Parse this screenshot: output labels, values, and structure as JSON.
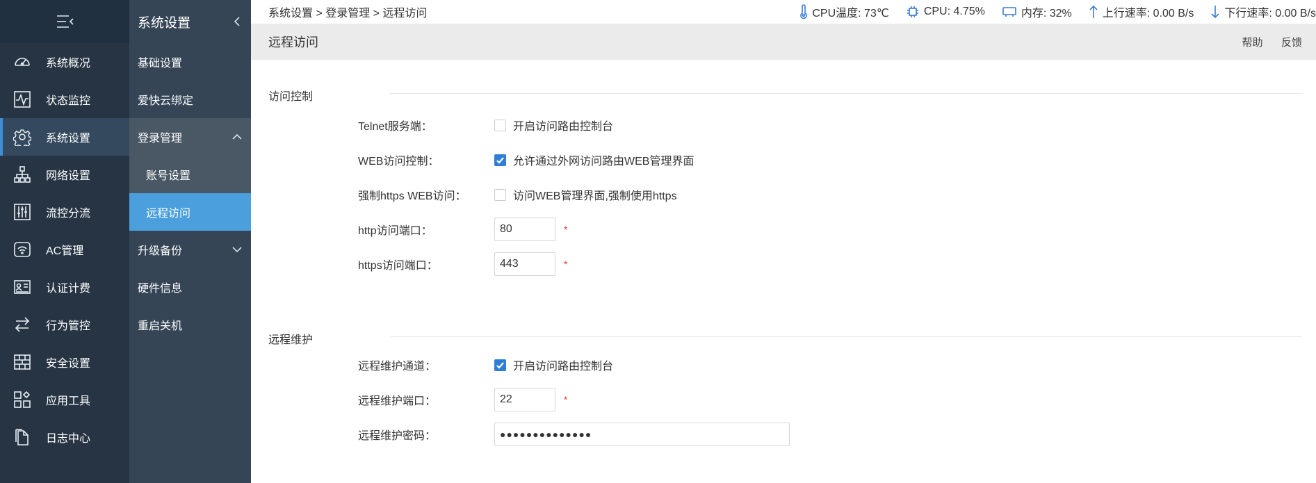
{
  "nav1": {
    "items": [
      {
        "label": "系统概况",
        "icon": "dashboard-icon"
      },
      {
        "label": "状态监控",
        "icon": "monitor-icon"
      },
      {
        "label": "系统设置",
        "icon": "gear-icon"
      },
      {
        "label": "网络设置",
        "icon": "network-icon"
      },
      {
        "label": "流控分流",
        "icon": "sliders-icon"
      },
      {
        "label": "AC管理",
        "icon": "wifi-icon"
      },
      {
        "label": "认证计费",
        "icon": "id-card-icon"
      },
      {
        "label": "行为管控",
        "icon": "arrows-icon"
      },
      {
        "label": "安全设置",
        "icon": "firewall-icon"
      },
      {
        "label": "应用工具",
        "icon": "apps-icon"
      },
      {
        "label": "日志中心",
        "icon": "document-icon"
      }
    ]
  },
  "nav2": {
    "title": "系统设置",
    "items": {
      "basic": "基础设置",
      "cloud": "爱快云绑定",
      "login": "登录管理",
      "account": "账号设置",
      "remote": "远程访问",
      "upgrade": "升级备份",
      "hardware": "硬件信息",
      "reboot": "重启关机"
    }
  },
  "topbar": {
    "breadcrumb": "系统设置 > 登录管理 > 远程访问",
    "cpu_temp": "CPU温度: 73℃",
    "cpu": "CPU: 4.75%",
    "memory": "内存: 32%",
    "upload": "上行速率: 0.00 B/s",
    "download": "下行速率: 0.00 B/s"
  },
  "titlebar": {
    "title": "远程访问",
    "help": "帮助",
    "feedback": "反馈"
  },
  "access": {
    "section": "访问控制",
    "telnet_label": "Telnet服务端：",
    "telnet_text": "开启访问路由控制台",
    "telnet_checked": false,
    "web_label": "WEB访问控制：",
    "web_text": "允许通过外网访问路由WEB管理界面",
    "web_checked": true,
    "https_label": "强制https WEB访问：",
    "https_text": "访问WEB管理界面,强制使用https",
    "https_checked": false,
    "http_port_label": "http访问端口：",
    "http_port": "80",
    "https_port_label": "https访问端口：",
    "https_port": "443",
    "required": "*"
  },
  "maintenance": {
    "section": "远程维护",
    "channel_label": "远程维护通道：",
    "channel_text": "开启访问路由控制台",
    "channel_checked": true,
    "port_label": "远程维护端口：",
    "port": "22",
    "password_label": "远程维护密码：",
    "password": "●●●●●●●●●●●●●●",
    "required": "*"
  },
  "colors": {
    "nav_bg": "#263443",
    "subnav_bg": "#354556",
    "active_blue": "#4a9fdc",
    "checkbox_blue": "#2f7fd8",
    "required_red": "#ee3333"
  }
}
